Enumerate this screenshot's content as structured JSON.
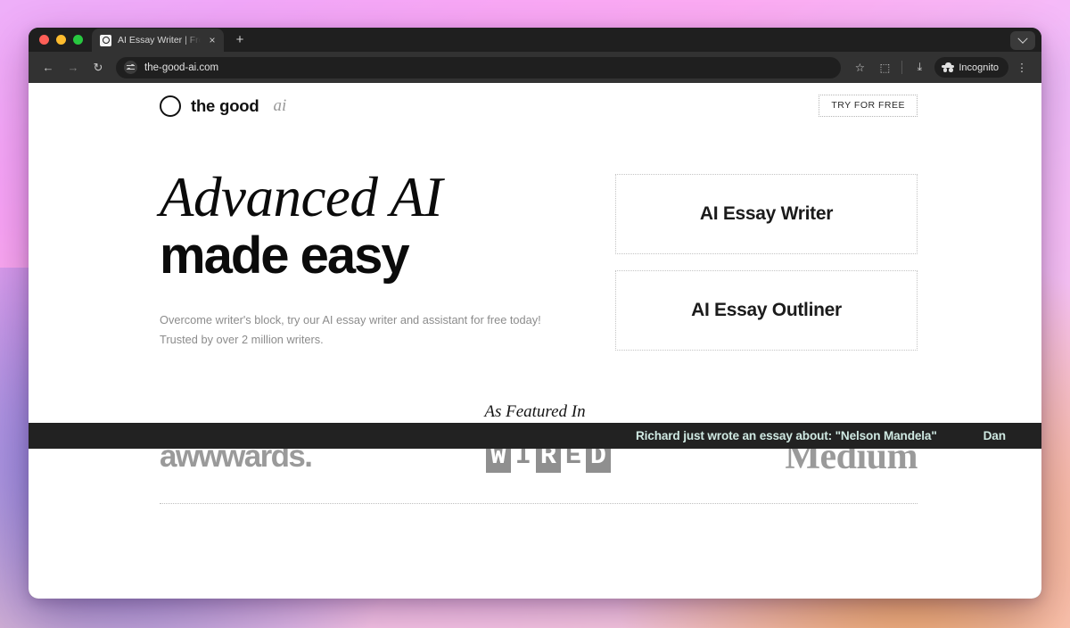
{
  "browser": {
    "tab": {
      "title": "AI Essay Writer | Free Essay W",
      "close_label": "×",
      "favicon_name": "circle-logo-favicon"
    },
    "new_tab_label": "+",
    "toolbar": {
      "back_label": "←",
      "forward_label": "→",
      "reload_label": "↻",
      "url": "the-good-ai.com",
      "bookmark_label": "☆",
      "extensions_label": "⬚",
      "download_label": "⤓",
      "incognito_label": "Incognito",
      "menu_label": "⋮"
    },
    "tabstrip_menu_label": ""
  },
  "site": {
    "header": {
      "brand_name": "the good",
      "brand_suffix": "ai",
      "cta_label": "TRY FOR FREE"
    },
    "hero": {
      "heading_serif": "Advanced AI",
      "heading_sans": "made easy",
      "subtitle_line1": "Overcome writer's block, try our AI essay writer and assistant for free today!",
      "subtitle_line2": "Trusted by over 2 million writers.",
      "cards": [
        {
          "label": "AI Essay Writer"
        },
        {
          "label": "AI Essay Outliner"
        }
      ]
    },
    "ticker": {
      "items": [
        "Richard just wrote an essay about: \"Nelson Mandela\"",
        "Dan"
      ]
    },
    "featured": {
      "title": "As Featured In",
      "logos": [
        {
          "name": "awwwards",
          "text": "awwwards."
        },
        {
          "name": "wired",
          "letters": [
            {
              "char": "W",
              "boxed": true
            },
            {
              "char": "I",
              "boxed": false
            },
            {
              "char": "R",
              "boxed": true
            },
            {
              "char": "E",
              "boxed": false
            },
            {
              "char": "D",
              "boxed": true
            }
          ]
        },
        {
          "name": "medium",
          "text": "Medium"
        }
      ]
    }
  },
  "colors": {
    "ticker_bg": "#222222",
    "ticker_text": "#cfe9e2",
    "logo_gray": "#9a9a9a",
    "browser_chrome": "#323232"
  }
}
